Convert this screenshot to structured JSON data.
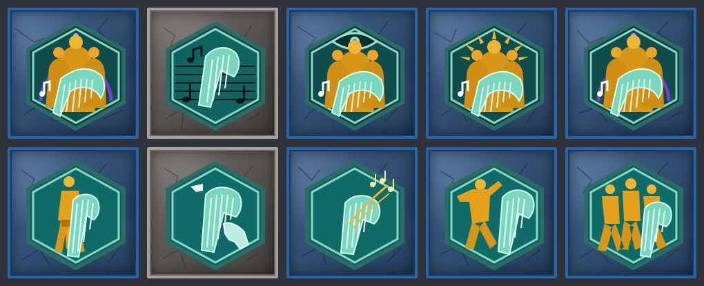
{
  "palette": {
    "frame_blue": "#2b63a8",
    "frame_stone": "#a5a09b",
    "dark_teal": "#09383a",
    "teal": "#0c5a57",
    "mint": "#74d7bd",
    "gold": "#e7a51f",
    "purple": "#7b3ec2"
  },
  "icons": [
    {
      "icon": "group-harp-ring-icon",
      "frame": "blue"
    },
    {
      "icon": "harp-music-staff-icon",
      "frame": "stone"
    },
    {
      "icon": "group-harp-eye-icon",
      "frame": "blue"
    },
    {
      "icon": "group-harp-sunburst-icon",
      "frame": "blue"
    },
    {
      "icon": "group-harp-ring-icon",
      "frame": "blue"
    },
    {
      "icon": "harpist-player-icon",
      "frame": "blue"
    },
    {
      "icon": "harp-hand-icon",
      "frame": "stone"
    },
    {
      "icon": "harp-notes-icon",
      "frame": "blue"
    },
    {
      "icon": "harp-dancer-icon",
      "frame": "blue"
    },
    {
      "icon": "harp-dancers-group-icon",
      "frame": "blue"
    }
  ]
}
